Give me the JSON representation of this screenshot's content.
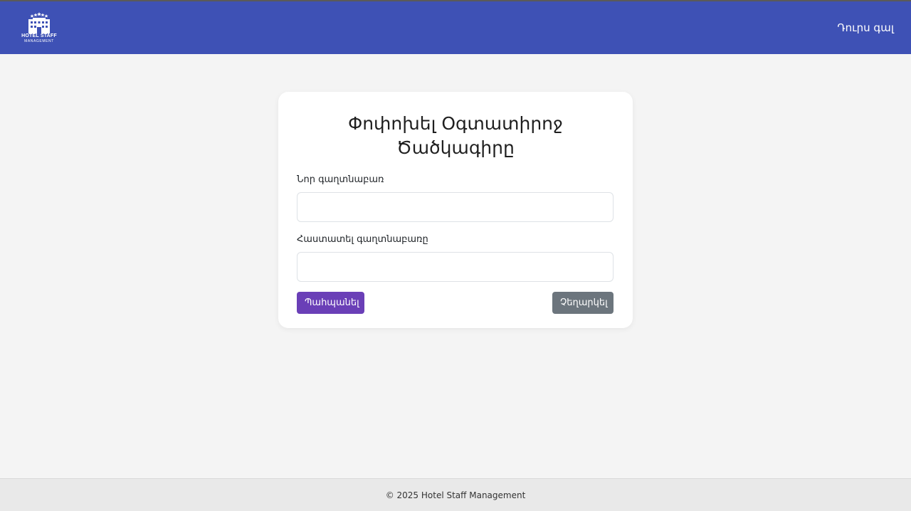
{
  "header": {
    "logo_line1": "HOTEL STAFF",
    "logo_line2": "MANAGEMENT",
    "logout_label": "Դուրս գալ"
  },
  "form": {
    "title": "Փոփոխել Օգտատիրոջ Ծածկագիրը",
    "new_password_label": "Նոր գաղտնաբառ",
    "new_password_value": "",
    "confirm_password_label": "Հաստատել գաղտնաբառը",
    "confirm_password_value": "",
    "save_label": "Պահպանել",
    "cancel_label": "Չեղարկել"
  },
  "footer": {
    "text": "© 2025 Hotel Staff Management"
  },
  "colors": {
    "navbar": "#3e51b5",
    "save_button": "#6a3fb7",
    "cancel_button": "#6c757d",
    "page_background": "#f4f4f4"
  },
  "icons": {
    "logo": "hotel-building-icon"
  }
}
